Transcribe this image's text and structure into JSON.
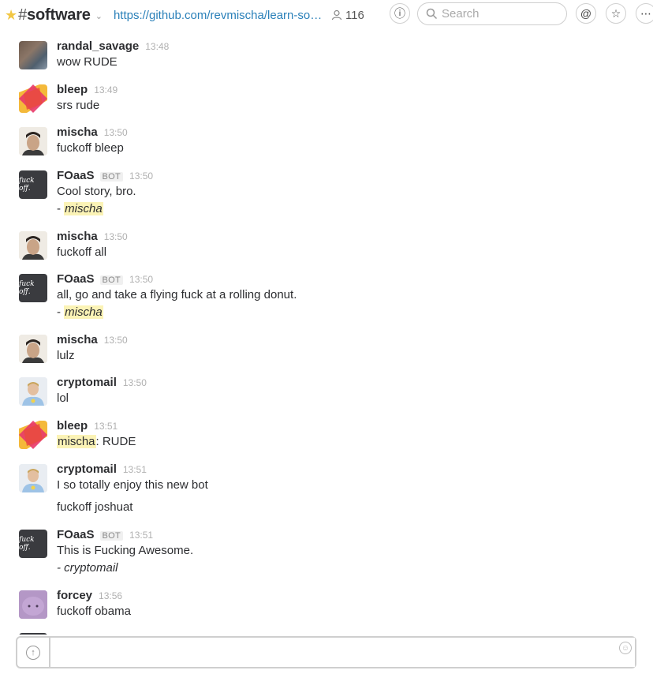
{
  "header": {
    "channel_hash": "#",
    "channel_name": "software",
    "topic": "https://github.com/revmischa/learn-soft...",
    "member_count": "116",
    "search_placeholder": "Search"
  },
  "messages": [
    {
      "sender": "randal_savage",
      "time": "13:48",
      "bot": false,
      "lines": [
        "wow RUDE"
      ],
      "avatar": "randal"
    },
    {
      "sender": "bleep",
      "time": "13:49",
      "bot": false,
      "lines": [
        "srs rude"
      ],
      "avatar": "bleep"
    },
    {
      "sender": "mischa",
      "time": "13:50",
      "bot": false,
      "lines": [
        "fuckoff bleep"
      ],
      "avatar": "mischa"
    },
    {
      "sender": "FOaaS",
      "time": "13:50",
      "bot": true,
      "bot_label": "BOT",
      "lines": [
        "Cool story, bro.",
        "- ",
        "mischa"
      ],
      "avatar": "foaas"
    },
    {
      "sender": "mischa",
      "time": "13:50",
      "bot": false,
      "lines": [
        "fuckoff all"
      ],
      "avatar": "mischa"
    },
    {
      "sender": "FOaaS",
      "time": "13:50",
      "bot": true,
      "bot_label": "BOT",
      "lines": [
        "all, go and take a flying fuck at a rolling donut.",
        "- ",
        "mischa"
      ],
      "avatar": "foaas"
    },
    {
      "sender": "mischa",
      "time": "13:50",
      "bot": false,
      "lines": [
        "lulz"
      ],
      "avatar": "mischa"
    },
    {
      "sender": "cryptomail",
      "time": "13:50",
      "bot": false,
      "lines": [
        "lol"
      ],
      "avatar": "crypto"
    },
    {
      "sender": "bleep",
      "time": "13:51",
      "bot": false,
      "lines": [
        "mischa",
        ": RUDE"
      ],
      "avatar": "bleep"
    },
    {
      "sender": "cryptomail",
      "time": "13:51",
      "bot": false,
      "lines": [
        "I so totally enjoy this new bot",
        "fuckoff joshuat"
      ],
      "avatar": "crypto"
    },
    {
      "sender": "FOaaS",
      "time": "13:51",
      "bot": true,
      "bot_label": "BOT",
      "lines": [
        "This is Fucking Awesome.",
        "- cryptomail"
      ],
      "avatar": "foaas"
    },
    {
      "sender": "forcey",
      "time": "13:56",
      "bot": false,
      "lines": [
        "fuckoff obama"
      ],
      "avatar": "forcey"
    }
  ],
  "avatar_text": {
    "foaas": "fuck off."
  },
  "colors": {
    "accent_link": "#2a80b9",
    "mention_bg": "#fbf3b6",
    "star": "#f2c744"
  },
  "icons": [
    "star-icon",
    "chevron-down-icon",
    "user-icon",
    "info-icon",
    "search-icon",
    "at-icon",
    "star-outline-icon",
    "more-icon",
    "upload-icon",
    "emoji-icon"
  ]
}
